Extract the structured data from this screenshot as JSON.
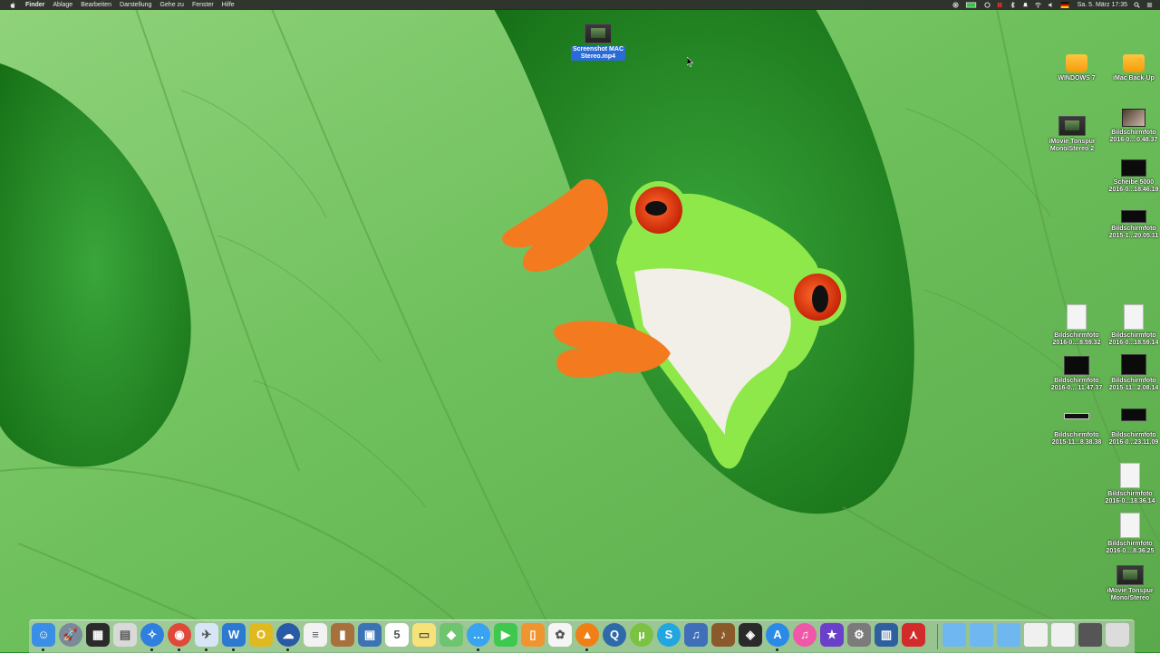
{
  "menubar": {
    "items": [
      {
        "label": "Finder",
        "bold": true
      },
      {
        "label": "Ablage"
      },
      {
        "label": "Bearbeiten"
      },
      {
        "label": "Darstellung"
      },
      {
        "label": "Gehe zu"
      },
      {
        "label": "Fenster"
      },
      {
        "label": "Hilfe"
      }
    ],
    "clock": "Sa. 5. März  17:35"
  },
  "desktop": {
    "selected_file": {
      "label": "Screenshot MAC\nStereo.mp4"
    },
    "icons": [
      {
        "id": "windows-drive",
        "label": "WINDOWS 7",
        "kind": "drive"
      },
      {
        "id": "imac-backup-drive",
        "label": "iMac Back-Up",
        "kind": "drive"
      },
      {
        "id": "imovie-tonspur-2",
        "label": "iMovie Tonspur\nMono/Stereo 2",
        "kind": "video"
      },
      {
        "id": "bildschirmfoto-1",
        "label": "Bildschirmfoto\n2016-0....0.48.37",
        "kind": "photo"
      },
      {
        "id": "scheibe-5000",
        "label": "Scheibe 5000\n2016-0...18.46.19",
        "kind": "shot-dark"
      },
      {
        "id": "bildschirmfoto-2",
        "label": "Bildschirmfoto\n2015-1...20.05.11",
        "kind": "shot-dark"
      },
      {
        "id": "bildschirmfoto-3",
        "label": "Bildschirmfoto\n2016-0....8.59.32",
        "kind": "shot-doc"
      },
      {
        "id": "bildschirmfoto-4",
        "label": "Bildschirmfoto\n2016-0...18.59.14",
        "kind": "shot-doc"
      },
      {
        "id": "bildschirmfoto-5",
        "label": "Bildschirmfoto\n2016-0....11.47.37",
        "kind": "shot-dark"
      },
      {
        "id": "bildschirmfoto-6",
        "label": "Bildschirmfoto\n2015-11...2.08.14",
        "kind": "shot-dark"
      },
      {
        "id": "bildschirmfoto-7",
        "label": "Bildschirmfoto\n2015-11...8.38.38",
        "kind": "shot-wide"
      },
      {
        "id": "bildschirmfoto-8",
        "label": "Bildschirmfoto\n2016-0...23.11.09",
        "kind": "shot-dark"
      },
      {
        "id": "bildschirmfoto-9",
        "label": "Bildschirmfoto\n2016-0...18.36.14",
        "kind": "shot-doc"
      },
      {
        "id": "bildschirmfoto-10",
        "label": "Bildschirmfoto\n2016-0....8.36.25",
        "kind": "shot-doc"
      },
      {
        "id": "imovie-tonspur",
        "label": "iMovie Tonspur\nMono/Stereo",
        "kind": "video"
      }
    ]
  },
  "dock": {
    "apps": [
      {
        "name": "finder-icon",
        "color": "#3a8ee6",
        "glyph": "☺"
      },
      {
        "name": "launchpad-icon",
        "color": "#7a8a9a",
        "glyph": "🚀"
      },
      {
        "name": "mission-control-icon",
        "color": "#2b2b2b",
        "glyph": "▦"
      },
      {
        "name": "preview-icon",
        "color": "#d9d9d9",
        "glyph": "▤"
      },
      {
        "name": "safari-icon",
        "color": "#2f7fe0",
        "glyph": "✧"
      },
      {
        "name": "chrome-icon",
        "color": "#e0483a",
        "glyph": "◉"
      },
      {
        "name": "mail-icon",
        "color": "#d7e6f7",
        "glyph": "✈"
      },
      {
        "name": "word-icon",
        "color": "#2b79d0",
        "glyph": "W"
      },
      {
        "name": "opera-icon",
        "color": "#e0b91f",
        "glyph": "O"
      },
      {
        "name": "teamspeak-icon",
        "color": "#2a5aa5",
        "glyph": "☁"
      },
      {
        "name": "notes-icon",
        "color": "#f2f2f2",
        "glyph": "≡"
      },
      {
        "name": "contacts-icon",
        "color": "#a8703d",
        "glyph": "▮"
      },
      {
        "name": "photo-booth-icon",
        "color": "#3c73b3",
        "glyph": "▣"
      },
      {
        "name": "calendar-icon",
        "color": "#ffffff",
        "glyph": "5"
      },
      {
        "name": "stickies-icon",
        "color": "#f7e27a",
        "glyph": "▭"
      },
      {
        "name": "maps-icon",
        "color": "#6fc46f",
        "glyph": "◆"
      },
      {
        "name": "messages-icon",
        "color": "#37a3f1",
        "glyph": "…"
      },
      {
        "name": "facetime-icon",
        "color": "#3ec84e",
        "glyph": "▶"
      },
      {
        "name": "ibooks-icon",
        "color": "#f0942f",
        "glyph": "▯"
      },
      {
        "name": "photos-icon",
        "color": "#f5f5f5",
        "glyph": "✿"
      },
      {
        "name": "vlc-icon",
        "color": "#f07f16",
        "glyph": "▲"
      },
      {
        "name": "quicktime-icon",
        "color": "#2f6aa8",
        "glyph": "Q"
      },
      {
        "name": "utorrent-icon",
        "color": "#7cc242",
        "glyph": "µ"
      },
      {
        "name": "skype-icon",
        "color": "#22a6e0",
        "glyph": "S"
      },
      {
        "name": "audio-app-icon",
        "color": "#3e6fb8",
        "glyph": "♫"
      },
      {
        "name": "instrument-icon",
        "color": "#8b5a2b",
        "glyph": "♪"
      },
      {
        "name": "xld-icon",
        "color": "#2a2a2a",
        "glyph": "◈"
      },
      {
        "name": "app-store-icon",
        "color": "#2a8ae8",
        "glyph": "A"
      },
      {
        "name": "itunes-icon",
        "color": "#f057a8",
        "glyph": "♫"
      },
      {
        "name": "imovie-icon",
        "color": "#6a3fc9",
        "glyph": "★"
      },
      {
        "name": "system-preferences-icon",
        "color": "#7b7b7b",
        "glyph": "⚙"
      },
      {
        "name": "mac-tool-icon",
        "color": "#2f5f9f",
        "glyph": "▥"
      },
      {
        "name": "acrobat-icon",
        "color": "#d12b2b",
        "glyph": "⋏"
      }
    ],
    "stacks": [
      {
        "name": "folder-stack-1-icon",
        "color": "#6fb7f0"
      },
      {
        "name": "folder-stack-2-icon",
        "color": "#6fb7f0"
      },
      {
        "name": "folder-stack-3-icon",
        "color": "#6fb7f0"
      },
      {
        "name": "document-stack-1-icon",
        "color": "#f0f0f0"
      },
      {
        "name": "document-stack-2-icon",
        "color": "#f0f0f0"
      },
      {
        "name": "screenshot-stack-icon",
        "color": "#555555"
      },
      {
        "name": "trash-icon",
        "color": "#dcdcdc"
      }
    ]
  }
}
